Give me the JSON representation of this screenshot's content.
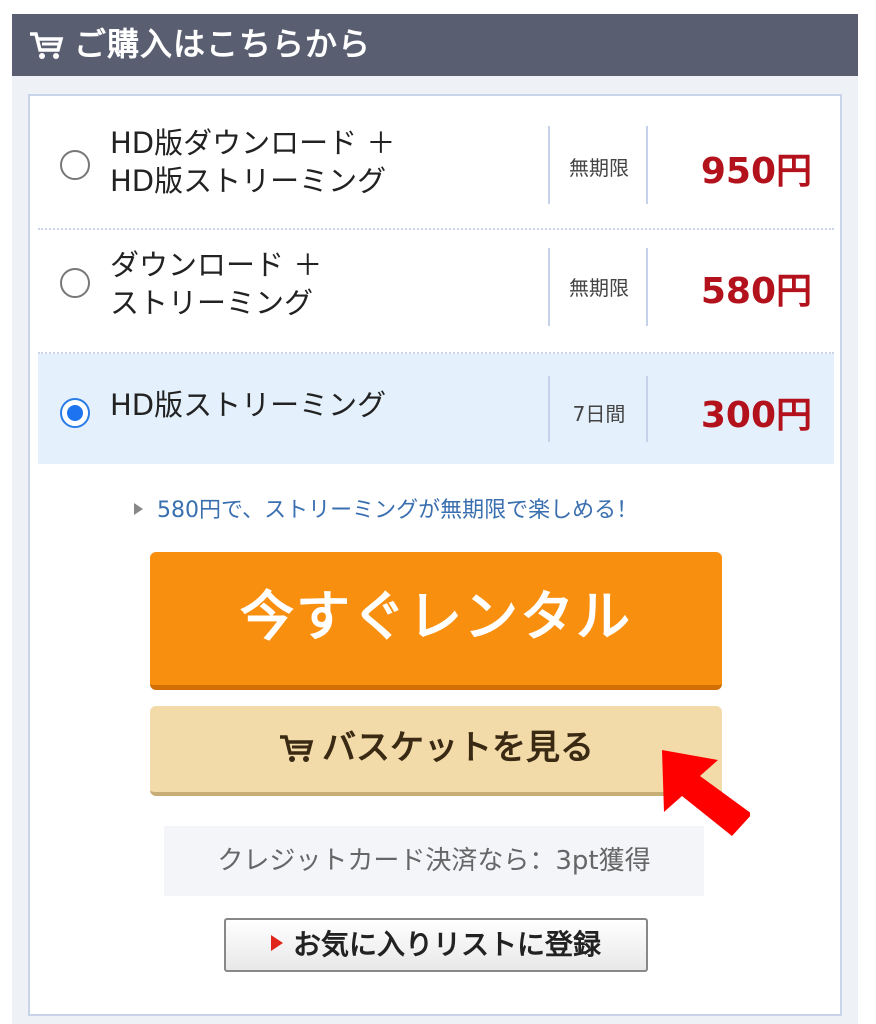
{
  "header": {
    "title": "ご購入はこちらから",
    "icon": "cart-icon"
  },
  "options": [
    {
      "name_line1": "HD版ダウンロード ＋",
      "name_line2": "HD版ストリーミング",
      "period": "無期限",
      "price": "950円",
      "selected": false
    },
    {
      "name_line1": "ダウンロード ＋",
      "name_line2": "ストリーミング",
      "period": "無期限",
      "price": "580円",
      "selected": false
    },
    {
      "name_line1": "HD版ストリーミング",
      "name_line2": "",
      "period": "7日間",
      "price": "300円",
      "selected": true
    }
  ],
  "promo": {
    "text": "580円で、ストリーミングが無期限で楽しめる！"
  },
  "buttons": {
    "rent_now": "今すぐレンタル",
    "view_basket": "バスケットを見る",
    "add_favorite": "お気に入りリストに登録"
  },
  "credit_note": "クレジットカード決済なら：3pt獲得",
  "colors": {
    "header_bg": "#595f70",
    "price": "#b3121c",
    "rent_button": "#f98f0e",
    "basket_button": "#f2dba9",
    "selected_row": "#e4f0fb",
    "arrow": "#ff0000"
  }
}
